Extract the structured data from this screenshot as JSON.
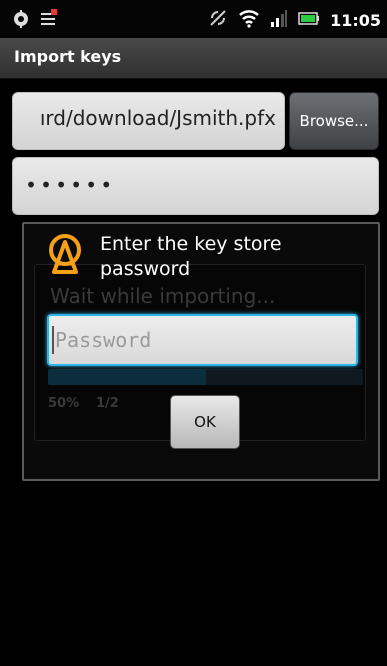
{
  "status_bar": {
    "time": "11:05",
    "icons": [
      "settings-icon",
      "notification-icon",
      "sync-icon",
      "wifi-icon",
      "signal-icon",
      "battery-icon"
    ]
  },
  "title_bar": {
    "title": "Import keys"
  },
  "form": {
    "file_path_value": "ırd/download/Jsmith.pfx",
    "browse_label": "Browse...",
    "password_value": "••••••"
  },
  "background_progress": {
    "title": "Wait while importing...",
    "percent_text": "50%",
    "count_text": "1/2",
    "progress": 0.5
  },
  "dialog": {
    "title": "Enter the key store password",
    "input_placeholder": "Password",
    "ok_label": "OK"
  },
  "colors": {
    "accent": "#2fb4e8",
    "icon_orange": "#f5a015"
  }
}
